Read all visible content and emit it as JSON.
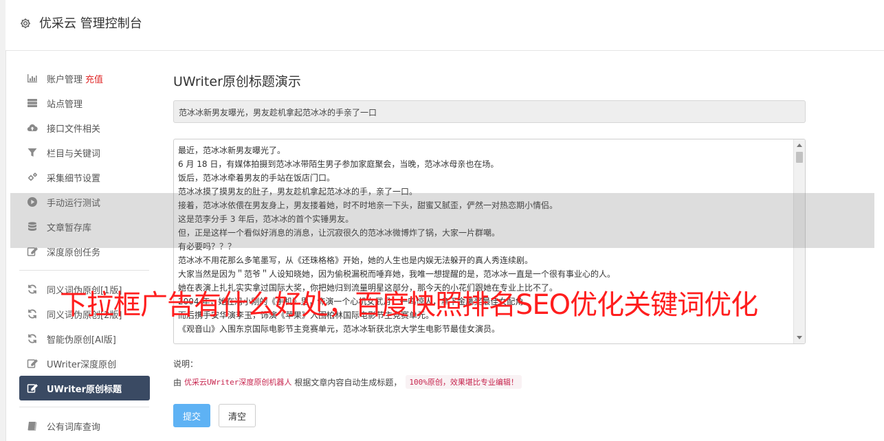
{
  "header": {
    "title": "优采云 管理控制台",
    "icon": "gear-icon"
  },
  "sidebar": {
    "group1": [
      {
        "label": "账户管理",
        "badge": "充值",
        "icon": "bar-chart-icon"
      },
      {
        "label": "站点管理",
        "icon": "server-icon"
      },
      {
        "label": "接口文件相关",
        "icon": "cloud-upload-icon"
      },
      {
        "label": "栏目与关键词",
        "icon": "filter-icon"
      },
      {
        "label": "采集细节设置",
        "icon": "cogs-icon"
      },
      {
        "label": "手动运行测试",
        "icon": "play-circle-icon"
      },
      {
        "label": "文章暂存库",
        "icon": "database-icon"
      },
      {
        "label": "深度原创任务",
        "icon": "edit-icon"
      }
    ],
    "group2": [
      {
        "label": "同义词伪原创[1版]",
        "icon": "refresh-icon"
      },
      {
        "label": "同义词伪原创[2版]",
        "icon": "refresh-icon"
      },
      {
        "label": "智能伪原创[AI版]",
        "icon": "refresh-icon"
      },
      {
        "label": "UWriter深度原创",
        "icon": "edit-icon"
      },
      {
        "label": "UWriter原创标题",
        "icon": "edit-icon",
        "active": true
      }
    ],
    "group3": [
      {
        "label": "公有词库查询",
        "icon": "book-icon"
      }
    ]
  },
  "main": {
    "heading": "UWriter原创标题演示",
    "title_value": "范冰冰新男友曝光，男友趁机拿起范冰冰的手亲了一口",
    "content_lines": [
      "最近，范冰冰新男友曝光了。",
      "6 月 18 日，有媒体拍摄到范冰冰带陌生男子参加家庭聚会，当晚，范冰冰母亲也在场。",
      "饭后，范冰冰牵着男友的手站在饭店门口。",
      "范冰冰摸了摸男友的肚子，男友趁机拿起范冰冰的手，亲了一口。",
      "接着，范冰冰依偎在男友身上，男友搂着她，时不时地亲一下头，甜蜜又腻歪，俨然一对热恋期小情侣。",
      "这是范李分手 3 年后，范冰冰的首个实锤男友。",
      "但，正是这样一个看似好消息的消息，让沉寂很久的范冰冰微博炸了锅，大家一片群嘲。",
      "有必要吗？？？",
      "范冰冰不用花那么多笔墨写，从《还珠格格》开始，她的人生也是内娱无法躲开的真人秀连续剧。",
      "大家当然是因为＂范爷＂人设知晓她，因为偷税漏税而唾弃她，我唯一想提醒的是，范冰冰一直是一个很有事业心的人。",
      "她在表演上扎扎实实拿过国际大奖，你把她归到流量明星这部分，那今天的小花们跟她在专业上比不了。",
      "2004 年，她在冯小刚的《手机》里，饰演一个心机女武月，一鸣惊人，拿下金鹰奖最佳女配角。",
      "而后携手安华演李玉，饰演《苹果》入围柏林国际电影节主竞赛单元。",
      "《观音山》入围东京国际电影节主竞赛单元，范冰冰斩获北京大学生电影节最佳女演员。"
    ],
    "note_label": "说明：",
    "note_prefix": "由",
    "note_link": "优采云UWriter深度原创机器人",
    "note_middle": "根据文章内容自动生成标题，",
    "note_tag": "100%原创，效果堪比专业编辑！",
    "submit_label": "提交",
    "clear_label": "清空"
  },
  "watermark": "下拉框广告有什么好处，百度快照排名SEO优化关键词优化"
}
